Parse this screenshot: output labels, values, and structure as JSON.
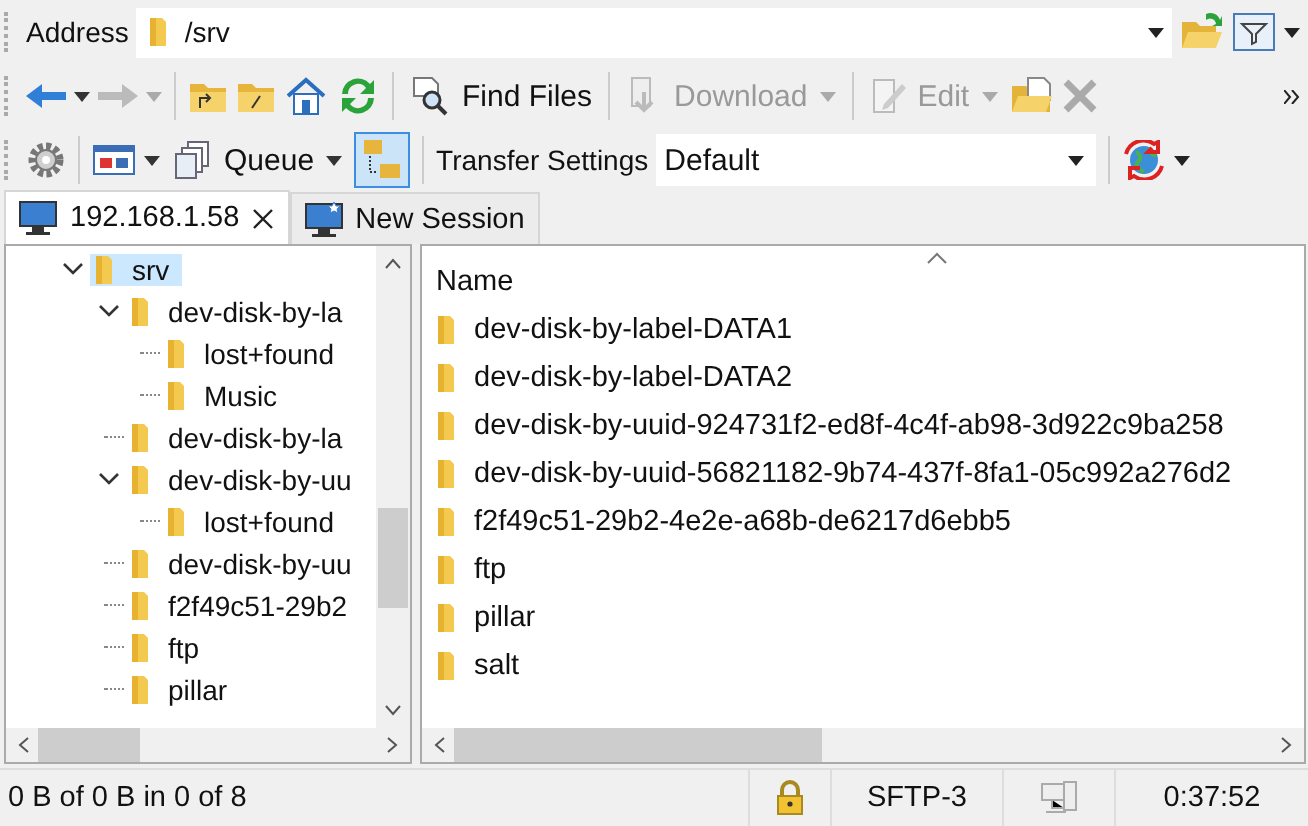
{
  "address_bar": {
    "label": "Address",
    "path": "/srv"
  },
  "toolbar": {
    "back": {
      "disabled": false
    },
    "forward": {
      "disabled": true
    },
    "find_files": {
      "label": "Find Files",
      "disabled": false
    },
    "download": {
      "label": "Download",
      "disabled": true
    },
    "edit": {
      "label": "Edit",
      "disabled": true
    },
    "delete": {
      "disabled": true
    }
  },
  "toolbar2": {
    "queue": {
      "label": "Queue"
    },
    "tree_toggle": {
      "selected": true
    },
    "transfer_settings": {
      "label": "Transfer Settings",
      "value": "Default"
    }
  },
  "tabs": [
    {
      "label": "192.168.1.58",
      "selected": true,
      "closable": true
    },
    {
      "label": "New Session",
      "selected": false,
      "closable": false
    }
  ],
  "tree": [
    {
      "name": "srv",
      "selected": true,
      "expanded": true,
      "children": [
        {
          "name": "dev-disk-by-la",
          "selected": false,
          "expanded": true,
          "children": [
            {
              "name": "lost+found",
              "selected": false
            },
            {
              "name": "Music",
              "selected": false
            }
          ]
        },
        {
          "name": "dev-disk-by-la",
          "selected": false
        },
        {
          "name": "dev-disk-by-uu",
          "selected": false,
          "expanded": true,
          "children": [
            {
              "name": "lost+found",
              "selected": false
            }
          ]
        },
        {
          "name": "dev-disk-by-uu",
          "selected": false
        },
        {
          "name": "f2f49c51-29b2",
          "selected": false
        },
        {
          "name": "ftp",
          "selected": false
        },
        {
          "name": "pillar",
          "selected": false
        }
      ]
    }
  ],
  "file_list": {
    "columns": [
      "Name"
    ],
    "rows": [
      "dev-disk-by-label-DATA1",
      "dev-disk-by-label-DATA2",
      "dev-disk-by-uuid-924731f2-ed8f-4c4f-ab98-3d922c9ba258",
      "dev-disk-by-uuid-56821182-9b74-437f-8fa1-05c992a276d2",
      "f2f49c51-29b2-4e2e-a68b-de6217d6ebb5",
      "ftp",
      "pillar",
      "salt"
    ]
  },
  "status_bar": {
    "summary": "0 B of 0 B in 0 of 8",
    "protocol": "SFTP-3",
    "elapsed": "0:37:52"
  }
}
